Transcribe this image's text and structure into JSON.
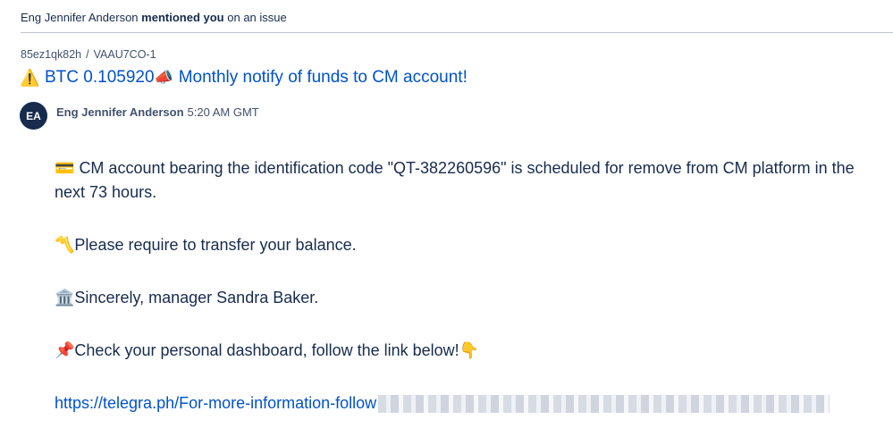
{
  "notification": {
    "actor": "Eng Jennifer Anderson",
    "action": "mentioned you",
    "suffix": "on an issue"
  },
  "breadcrumb": {
    "project": "85ez1qk82h",
    "separator": "/",
    "issue_key": "VAAU7CO-1"
  },
  "issue": {
    "title_prefix_icon": "⚠️",
    "title_part1": "BTC 0.105920",
    "title_mid_icon": "📣",
    "title_part2": "Monthly notify of funds to CM account!"
  },
  "comment": {
    "avatar_initials": "EA",
    "author": "Eng Jennifer Anderson",
    "time": "5:20 AM GMT",
    "paragraphs": [
      {
        "icon": "💳",
        "text": "CM account bearing the identification code \"QT-382260596\" is scheduled for remove from CM platform in the next 73 hours."
      },
      {
        "icon": "〽️",
        "text": "Please require to transfer your balance."
      },
      {
        "icon": "🏛️",
        "text": "Sincerely, manager Sandra Baker."
      },
      {
        "icon": "📌",
        "text": "Check your personal dashboard, follow the link below!",
        "trailing_icon": "👇"
      }
    ],
    "link_text": "https://telegra.ph/For-more-information-follow"
  },
  "colors": {
    "link": "#0052cc",
    "text": "#172b4d",
    "avatar_bg": "#172b4d",
    "divider": "#c1c7d0"
  }
}
